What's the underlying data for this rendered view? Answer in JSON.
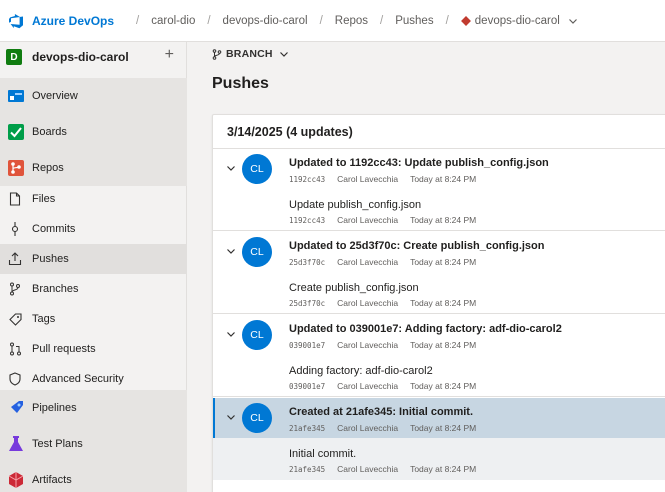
{
  "header": {
    "brand": "Azure DevOps",
    "breadcrumbs": [
      "carol-dio",
      "devops-dio-carol",
      "Repos",
      "Pushes",
      "devops-dio-carol"
    ],
    "separator": "/"
  },
  "sidebar": {
    "project": {
      "initial": "D",
      "name": "devops-dio-carol",
      "add": "+"
    },
    "items": [
      {
        "label": "Overview",
        "icon": "overview-icon"
      },
      {
        "label": "Boards",
        "icon": "boards-icon"
      },
      {
        "label": "Repos",
        "icon": "repos-icon"
      },
      {
        "label": "Files",
        "icon": "file-icon"
      },
      {
        "label": "Commits",
        "icon": "commit-icon"
      },
      {
        "label": "Pushes",
        "icon": "push-icon",
        "active": true
      },
      {
        "label": "Branches",
        "icon": "branch-icon"
      },
      {
        "label": "Tags",
        "icon": "tag-icon"
      },
      {
        "label": "Pull requests",
        "icon": "pull-request-icon"
      },
      {
        "label": "Advanced Security",
        "icon": "shield-icon"
      },
      {
        "label": "Pipelines",
        "icon": "pipelines-icon"
      },
      {
        "label": "Test Plans",
        "icon": "test-plans-icon"
      },
      {
        "label": "Artifacts",
        "icon": "artifacts-icon"
      }
    ]
  },
  "main": {
    "branch_label": "BRANCH",
    "page_title": "Pushes",
    "group_header": "3/14/2025 (4 updates)",
    "pushes": [
      {
        "avatar": "CL",
        "title": "Updated to 1192cc43: Update publish_config.json",
        "hash": "1192cc43",
        "author": "Carol Lavecchia",
        "time": "Today at 8:24 PM",
        "commit": {
          "title": "Update publish_config.json",
          "hash": "1192cc43",
          "author": "Carol Lavecchia",
          "time": "Today at 8:24 PM"
        }
      },
      {
        "avatar": "CL",
        "title": "Updated to 25d3f70c: Create publish_config.json",
        "hash": "25d3f70c",
        "author": "Carol Lavecchia",
        "time": "Today at 8:24 PM",
        "commit": {
          "title": "Create publish_config.json",
          "hash": "25d3f70c",
          "author": "Carol Lavecchia",
          "time": "Today at 8:24 PM"
        }
      },
      {
        "avatar": "CL",
        "title": "Updated to 039001e7: Adding factory: adf-dio-carol2",
        "hash": "039001e7",
        "author": "Carol Lavecchia",
        "time": "Today at 8:24 PM",
        "commit": {
          "title": "Adding factory: adf-dio-carol2",
          "hash": "039001e7",
          "author": "Carol Lavecchia",
          "time": "Today at 8:24 PM"
        }
      },
      {
        "avatar": "CL",
        "title": "Created at 21afe345: Initial commit.",
        "hash": "21afe345",
        "author": "Carol Lavecchia",
        "time": "Today at 8:24 PM",
        "selected": true,
        "commit": {
          "title": "Initial commit.",
          "hash": "21afe345",
          "author": "Carol Lavecchia",
          "time": "Today at 8:24 PM"
        }
      }
    ]
  },
  "colors": {
    "accent": "#0078d4",
    "project": "#107c10",
    "selected_row": "#c7d6e2"
  }
}
